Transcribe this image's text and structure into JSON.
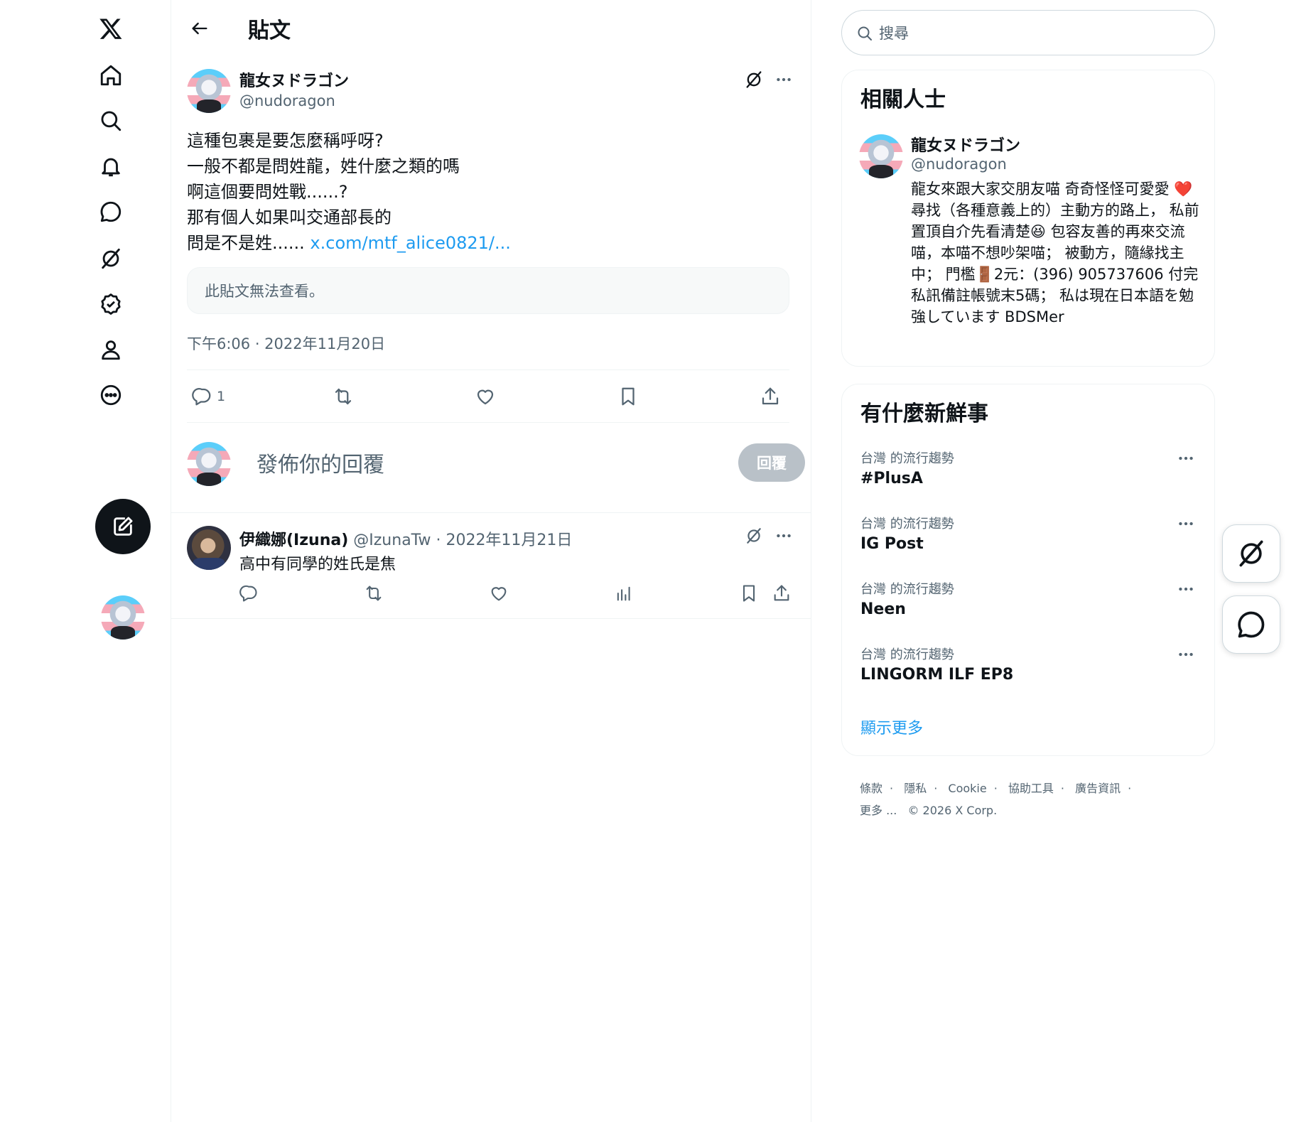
{
  "nav": {
    "items": [
      {
        "icon": "x-logo-icon"
      },
      {
        "icon": "home-icon"
      },
      {
        "icon": "search-icon"
      },
      {
        "icon": "bell-icon"
      },
      {
        "icon": "chat-bubble-icon"
      },
      {
        "icon": "grok-icon"
      },
      {
        "icon": "verified-badge-icon"
      },
      {
        "icon": "profile-icon"
      },
      {
        "icon": "more-circle-icon"
      }
    ],
    "compose_icon": "compose-icon"
  },
  "topbar": {
    "title": "貼文"
  },
  "post": {
    "author_name": "龍女ヌドラゴン",
    "author_handle": "@nudoragon",
    "body_lines": [
      "這種包裹是要怎麼稱呼呀?",
      "一般不都是問姓龍，姓什麼之類的嗎",
      "啊這個要問姓戰......?",
      "那有個人如果叫交通部長的",
      "問是不是姓......"
    ],
    "link_text": "x.com/mtf_alice0821/...",
    "unavailable": "此貼文無法查看。",
    "timestamp": "下午6:06 · 2022年11月20日",
    "reply_count": "1"
  },
  "reply_box": {
    "placeholder": "發佈你的回覆",
    "button": "回覆"
  },
  "reply": {
    "name": "伊織娜(Izuna)",
    "meta": " @IzunaTw · 2022年11月21日",
    "text": "高中有同學的姓氏是焦"
  },
  "search": {
    "placeholder": "搜尋"
  },
  "related": {
    "title": "相關人士",
    "name": "龍女ヌドラゴン",
    "handle": "@nudoragon",
    "bio": "龍女來跟大家交朋友喵 奇奇怪怪可愛愛 ❤️ 尋找（各種意義上的）主動方的路上， 私前置頂自介先看清楚😆 包容友善的再來交流喵，本喵不想吵架喵； 被動方，隨緣找主中； 門檻🚪2元：(396) 905737606 付完私訊備註帳號末5碼； 私は現在日本語を勉強しています BDSMer"
  },
  "trends": {
    "title": "有什麼新鮮事",
    "items": [
      {
        "meta": "台灣 的流行趨勢",
        "name": "#PlusA"
      },
      {
        "meta": "台灣 的流行趨勢",
        "name": "IG Post"
      },
      {
        "meta": "台灣 的流行趨勢",
        "name": "Neen"
      },
      {
        "meta": "台灣 的流行趨勢",
        "name": "LINGORM ILF EP8"
      }
    ],
    "show_more": "顯示更多"
  },
  "footer": {
    "links": [
      "條款",
      "隱私",
      "Cookie",
      "協助工具",
      "廣告資訊",
      "更多 ..."
    ],
    "copyright": "© 2026 X Corp."
  },
  "colors": {
    "accent": "#1d9bf0",
    "text": "#0f1419",
    "muted": "#536471",
    "border": "#eff3f4"
  }
}
